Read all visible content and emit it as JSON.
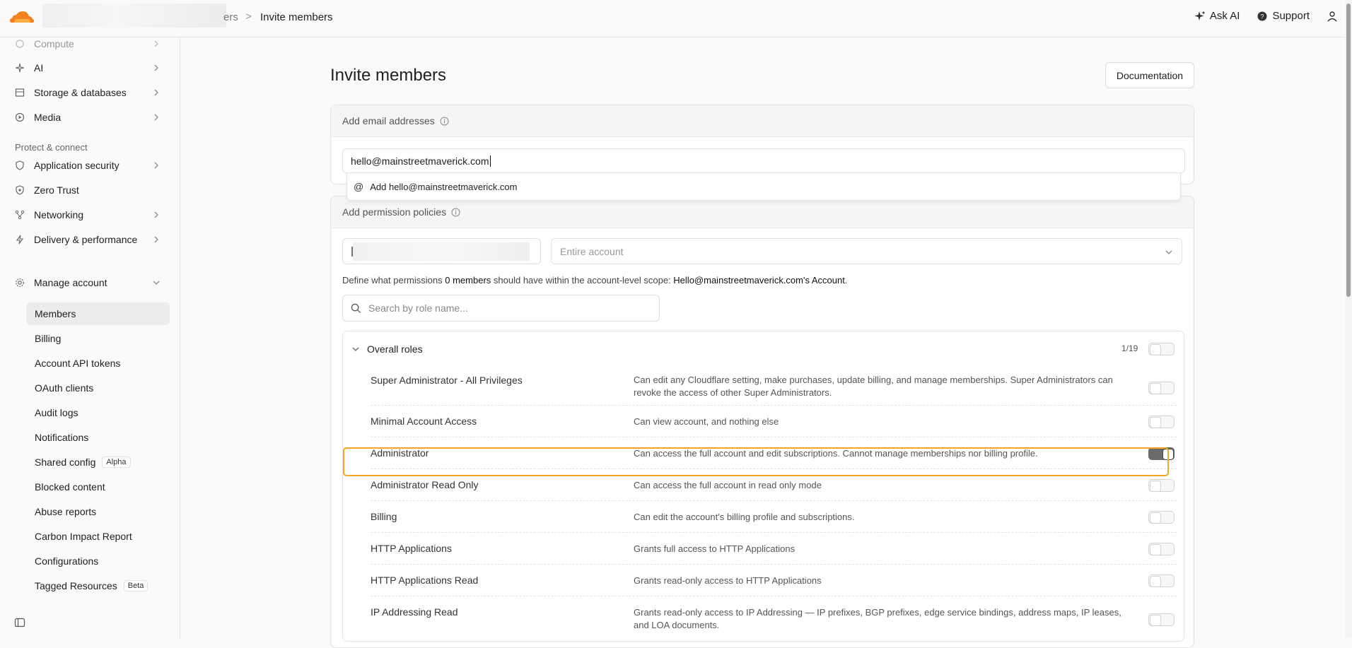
{
  "header": {
    "breadcrumb_prev": "ers",
    "breadcrumb_sep": ">",
    "breadcrumb_current": "Invite members",
    "ask_ai": "Ask AI",
    "support": "Support",
    "brand_color": "#f48120"
  },
  "sidebar": {
    "items_top": [
      {
        "label": "Compute",
        "icon": "compute-icon"
      },
      {
        "label": "AI",
        "icon": "sparkle-icon"
      },
      {
        "label": "Storage & databases",
        "icon": "database-icon"
      },
      {
        "label": "Media",
        "icon": "play-icon"
      }
    ],
    "section_protect": "Protect & connect",
    "items_protect": [
      {
        "label": "Application security",
        "icon": "shield-icon"
      },
      {
        "label": "Zero Trust",
        "icon": "zero-trust-icon"
      },
      {
        "label": "Networking",
        "icon": "network-icon"
      },
      {
        "label": "Delivery & performance",
        "icon": "bolt-icon"
      }
    ],
    "manage_account": "Manage account",
    "sub_items": [
      {
        "label": "Members",
        "tag": ""
      },
      {
        "label": "Billing",
        "tag": ""
      },
      {
        "label": "Account API tokens",
        "tag": ""
      },
      {
        "label": "OAuth clients",
        "tag": ""
      },
      {
        "label": "Audit logs",
        "tag": ""
      },
      {
        "label": "Notifications",
        "tag": ""
      },
      {
        "label": "Shared config",
        "tag": "Alpha"
      },
      {
        "label": "Blocked content",
        "tag": ""
      },
      {
        "label": "Abuse reports",
        "tag": ""
      },
      {
        "label": "Carbon Impact Report",
        "tag": ""
      },
      {
        "label": "Configurations",
        "tag": ""
      },
      {
        "label": "Tagged Resources",
        "tag": "Beta"
      }
    ]
  },
  "main": {
    "title": "Invite members",
    "documentation": "Documentation",
    "email_section": "Add email addresses",
    "email_value": "hello@mainstreetmaverick.com",
    "suggestion": "Add hello@mainstreetmaverick.com",
    "permission_section": "Add permission policies",
    "scope_placeholder": "Entire account",
    "define_pre": "Define what permissions",
    "define_count": "0 members",
    "define_mid": "should have within the account-level scope:",
    "define_account": "Hello@mainstreetmaverick.com's Account",
    "define_end": ".",
    "search_placeholder": "Search by role name...",
    "roles_group": "Overall roles",
    "roles_count": "1/19",
    "roles": [
      {
        "name": "Super Administrator - All Privileges",
        "desc": "Can edit any Cloudflare setting, make purchases, update billing, and manage memberships. Super Administrators can revoke the access of other Super Administrators.",
        "checked": false
      },
      {
        "name": "Minimal Account Access",
        "desc": "Can view account, and nothing else",
        "checked": false
      },
      {
        "name": "Administrator",
        "desc": "Can access the full account and edit subscriptions. Cannot manage memberships nor billing profile.",
        "checked": true
      },
      {
        "name": "Administrator Read Only",
        "desc": "Can access the full account in read only mode",
        "checked": false
      },
      {
        "name": "Billing",
        "desc": "Can edit the account's billing profile and subscriptions.",
        "checked": false
      },
      {
        "name": "HTTP Applications",
        "desc": "Grants full access to HTTP Applications",
        "checked": false
      },
      {
        "name": "HTTP Applications Read",
        "desc": "Grants read-only access to HTTP Applications",
        "checked": false
      },
      {
        "name": "IP Addressing Read",
        "desc": "Grants read-only access to IP Addressing — IP prefixes, BGP prefixes, edge service bindings, address maps, IP leases, and LOA documents.",
        "checked": false
      }
    ],
    "highlight_color": "#f5a623"
  }
}
